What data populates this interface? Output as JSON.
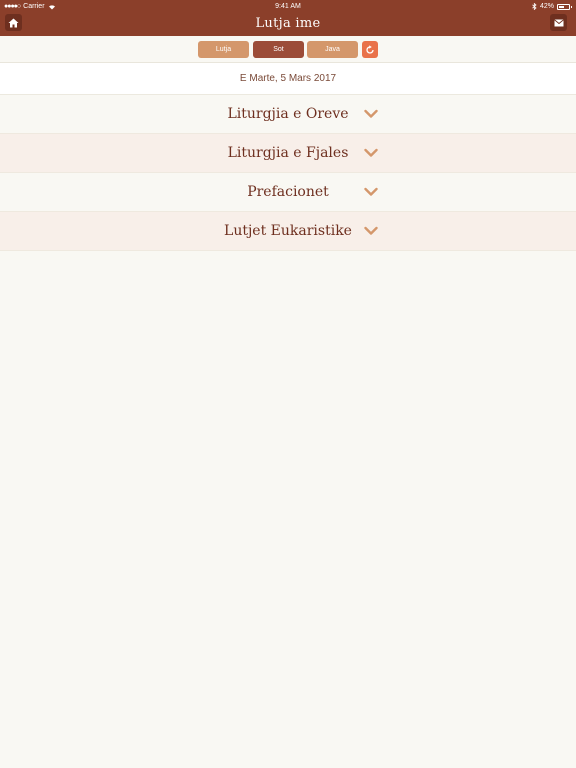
{
  "status_bar": {
    "carrier": "Carrier",
    "time": "9:41 AM",
    "battery_percent": "42%",
    "battery_level": 0.42
  },
  "nav": {
    "title": "Lutja  ime",
    "home_icon": "home-icon",
    "mail_icon": "mail-icon"
  },
  "segments": {
    "items": [
      {
        "label": "Lutja"
      },
      {
        "label": "Sot"
      },
      {
        "label": "Java"
      }
    ],
    "selected": "Sot",
    "refresh_icon": "refresh-icon"
  },
  "date": "E Marte,  5 Mars 2017",
  "sections": [
    {
      "title": "Liturgjia e Oreve"
    },
    {
      "title": "Liturgjia e Fjales"
    },
    {
      "title": "Prefacionet"
    },
    {
      "title": "Lutjet Eukaristike"
    }
  ],
  "colors": {
    "header": "#8b3f2a",
    "segment": "#d4976b",
    "segment_active": "#9c4c38",
    "refresh": "#e9724a",
    "chevron": "#d4976b",
    "section_title": "#6e2f1f"
  }
}
